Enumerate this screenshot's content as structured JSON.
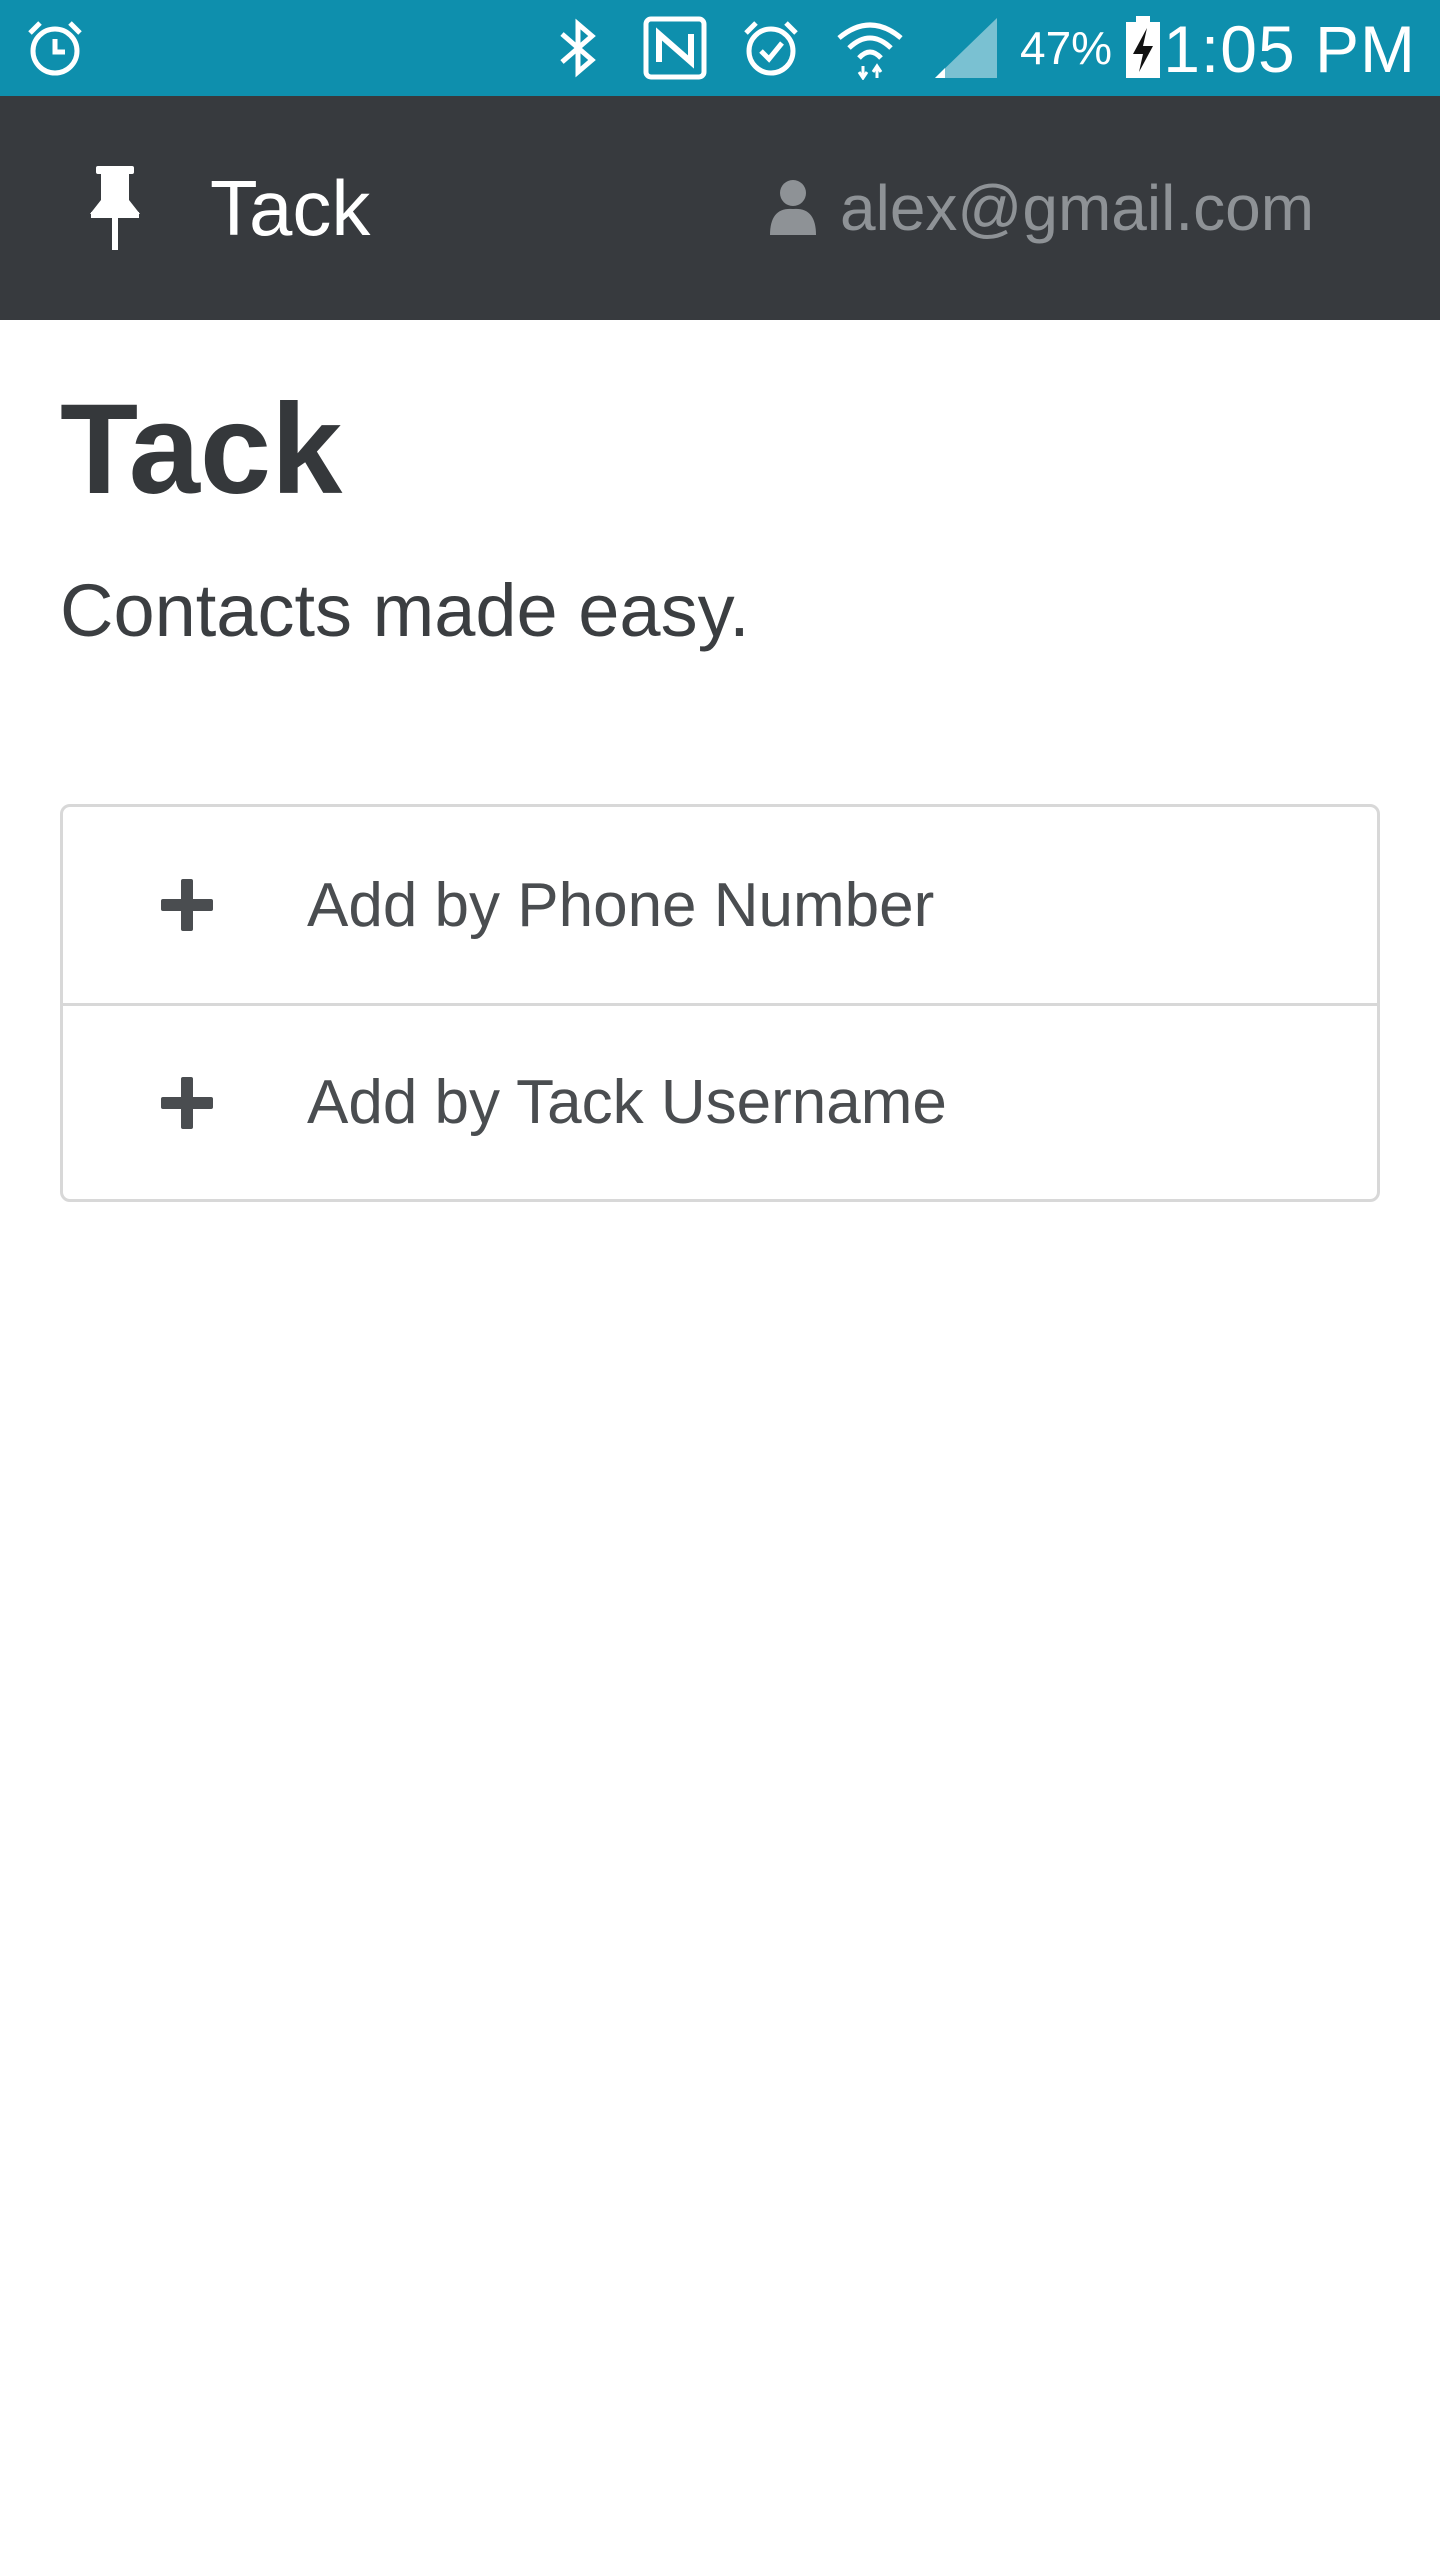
{
  "status_bar": {
    "icons": [
      "alarm-clock-icon",
      "bluetooth-icon",
      "nfc-icon",
      "alarm-check-icon",
      "wifi-icon",
      "cell-signal-icon",
      "battery-charging-icon"
    ],
    "battery_percent": "47%",
    "time": "1:05 PM",
    "background": "#0e8fad"
  },
  "header": {
    "brand_icon": "pushpin-icon",
    "brand_title": "Tack",
    "user_icon": "user-icon",
    "user_email": "alex@gmail.com",
    "background": "#373a3e"
  },
  "main": {
    "title": "Tack",
    "tagline": "Contacts made easy.",
    "actions": [
      {
        "icon": "plus-icon",
        "label": "Add by Phone Number"
      },
      {
        "icon": "plus-icon",
        "label": "Add by Tack Username"
      }
    ]
  }
}
